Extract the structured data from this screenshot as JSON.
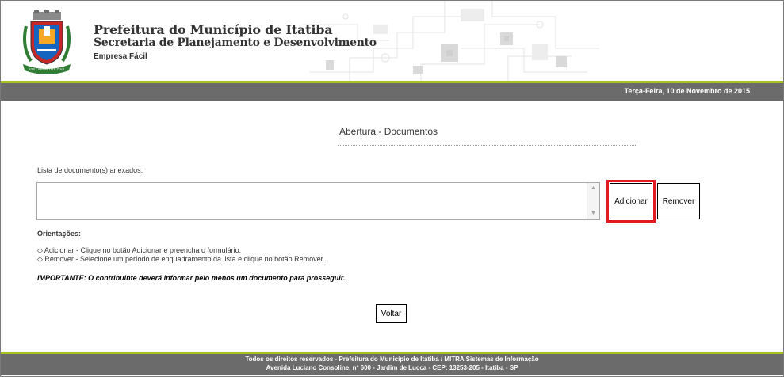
{
  "header": {
    "title": "Prefeitura do Município de Itatiba",
    "subtitle": "Secretaria de Planejamento e Desenvolvimento",
    "tagline": "Empresa Fácil",
    "date": "Terça-Feira, 10 de Novembro de 2015",
    "logo_banner": "VIS LABOR UTILITAS"
  },
  "main": {
    "title": "Abertura - Documentos",
    "list_label": "Lista de documento(s) anexados:",
    "buttons": {
      "add": "Adicionar",
      "remove": "Remover",
      "back": "Voltar"
    },
    "orientations_title": "Orientações:",
    "orientations": [
      "◇ Adicionar - Clique no botão Adicionar e preencha o formulário.",
      "◇ Remover - Selecione um período de enquadramento da lista e clique no botão Remover."
    ],
    "important": "IMPORTANTE: O contribuinte deverá informar pelo menos um documento para prosseguir."
  },
  "footer": {
    "line1": "Todos os direitos reservados - Prefeitura do Município de Itatiba / MITRA Sistemas de Informação",
    "line2": "Avenida Luciano Consoline, nº 600 - Jardim de Lucca - CEP: 13253-205 - Itatiba - SP"
  },
  "colors": {
    "accent_green": "#a6c21f",
    "bar_gray": "#6b6b6b",
    "highlight_red": "#e21b23"
  }
}
